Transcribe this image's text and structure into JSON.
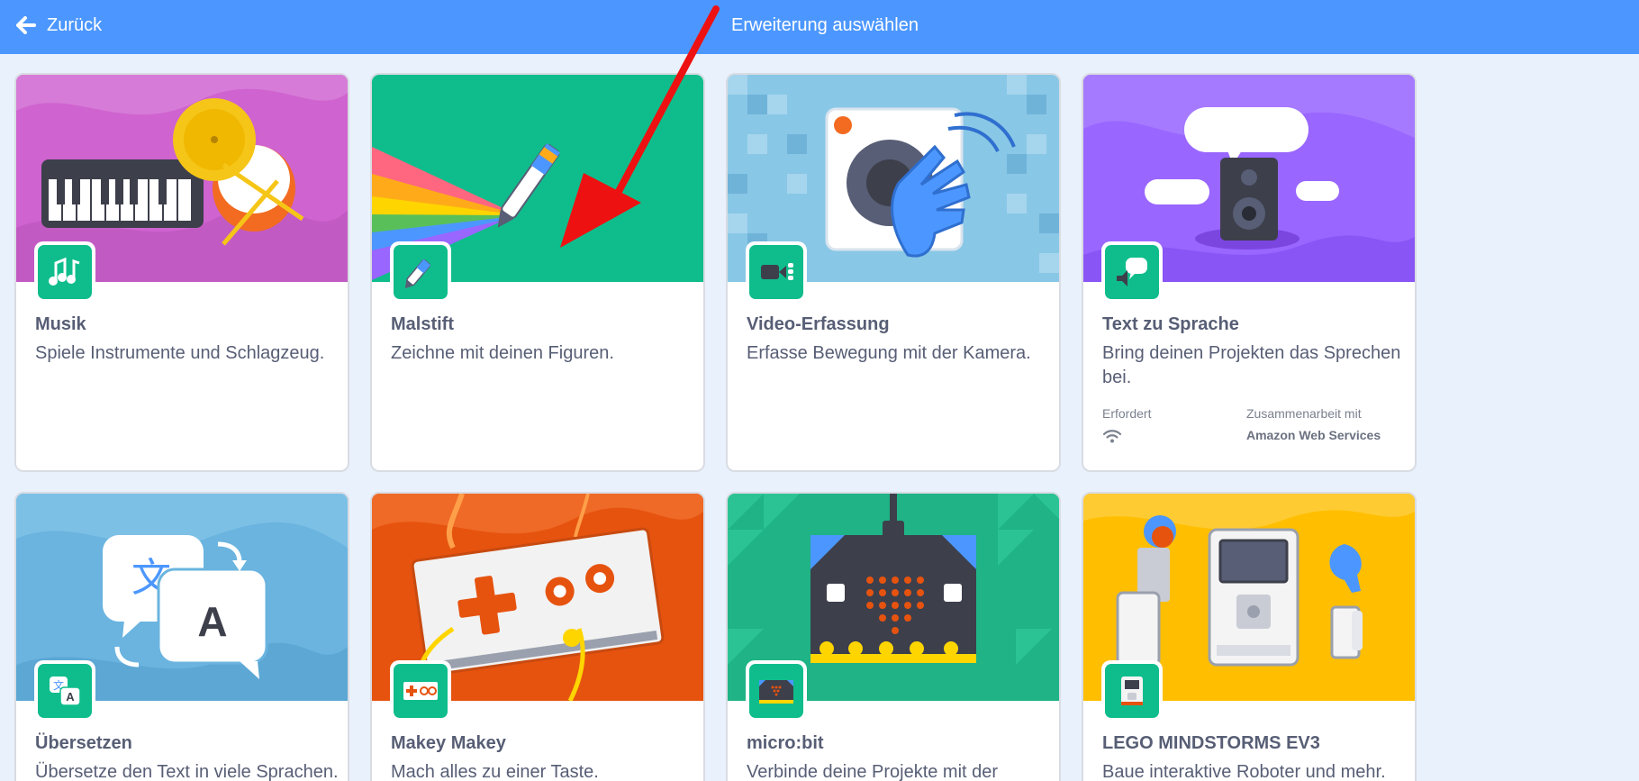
{
  "header": {
    "back_label": "Zurück",
    "title": "Erweiterung auswählen",
    "color": "#4c97ff"
  },
  "cards": [
    {
      "name": "Musik",
      "description": "Spiele Instrumente und Schlagzeug.",
      "color": "#cf63cf",
      "icon": "music-notes-icon"
    },
    {
      "name": "Malstift",
      "description": "Zeichne mit deinen Figuren.",
      "color": "#0fbd8c",
      "icon": "pen-icon"
    },
    {
      "name": "Video-Erfassung",
      "description": "Erfasse Bewegung mit der Kamera.",
      "color": "#89c7e6",
      "icon": "video-sensing-icon"
    },
    {
      "name": "Text zu Sprache",
      "description": "Bring deinen Projekten das Sprechen bei.",
      "color": "#9966ff",
      "icon": "speech-bubble-icon",
      "requires_label": "Erfordert",
      "collab_label": "Zusammenarbeit mit",
      "collab_value": "Amazon Web Services",
      "requires_icon": "wifi-icon"
    },
    {
      "name": "Übersetzen",
      "description": "Übersetze den Text in viele Sprachen.",
      "color": "#6ab4df",
      "icon": "translate-icon"
    },
    {
      "name": "Makey Makey",
      "description": "Mach alles zu einer Taste.",
      "color": "#e6530f",
      "icon": "makey-makey-icon"
    },
    {
      "name": "micro:bit",
      "description": "Verbinde deine Projekte mit der",
      "color": "#1fb386",
      "icon": "microbit-icon"
    },
    {
      "name": "LEGO MINDSTORMS EV3",
      "description": "Baue interaktive Roboter und mehr.",
      "color": "#ffbf00",
      "icon": "ev3-icon"
    }
  ]
}
